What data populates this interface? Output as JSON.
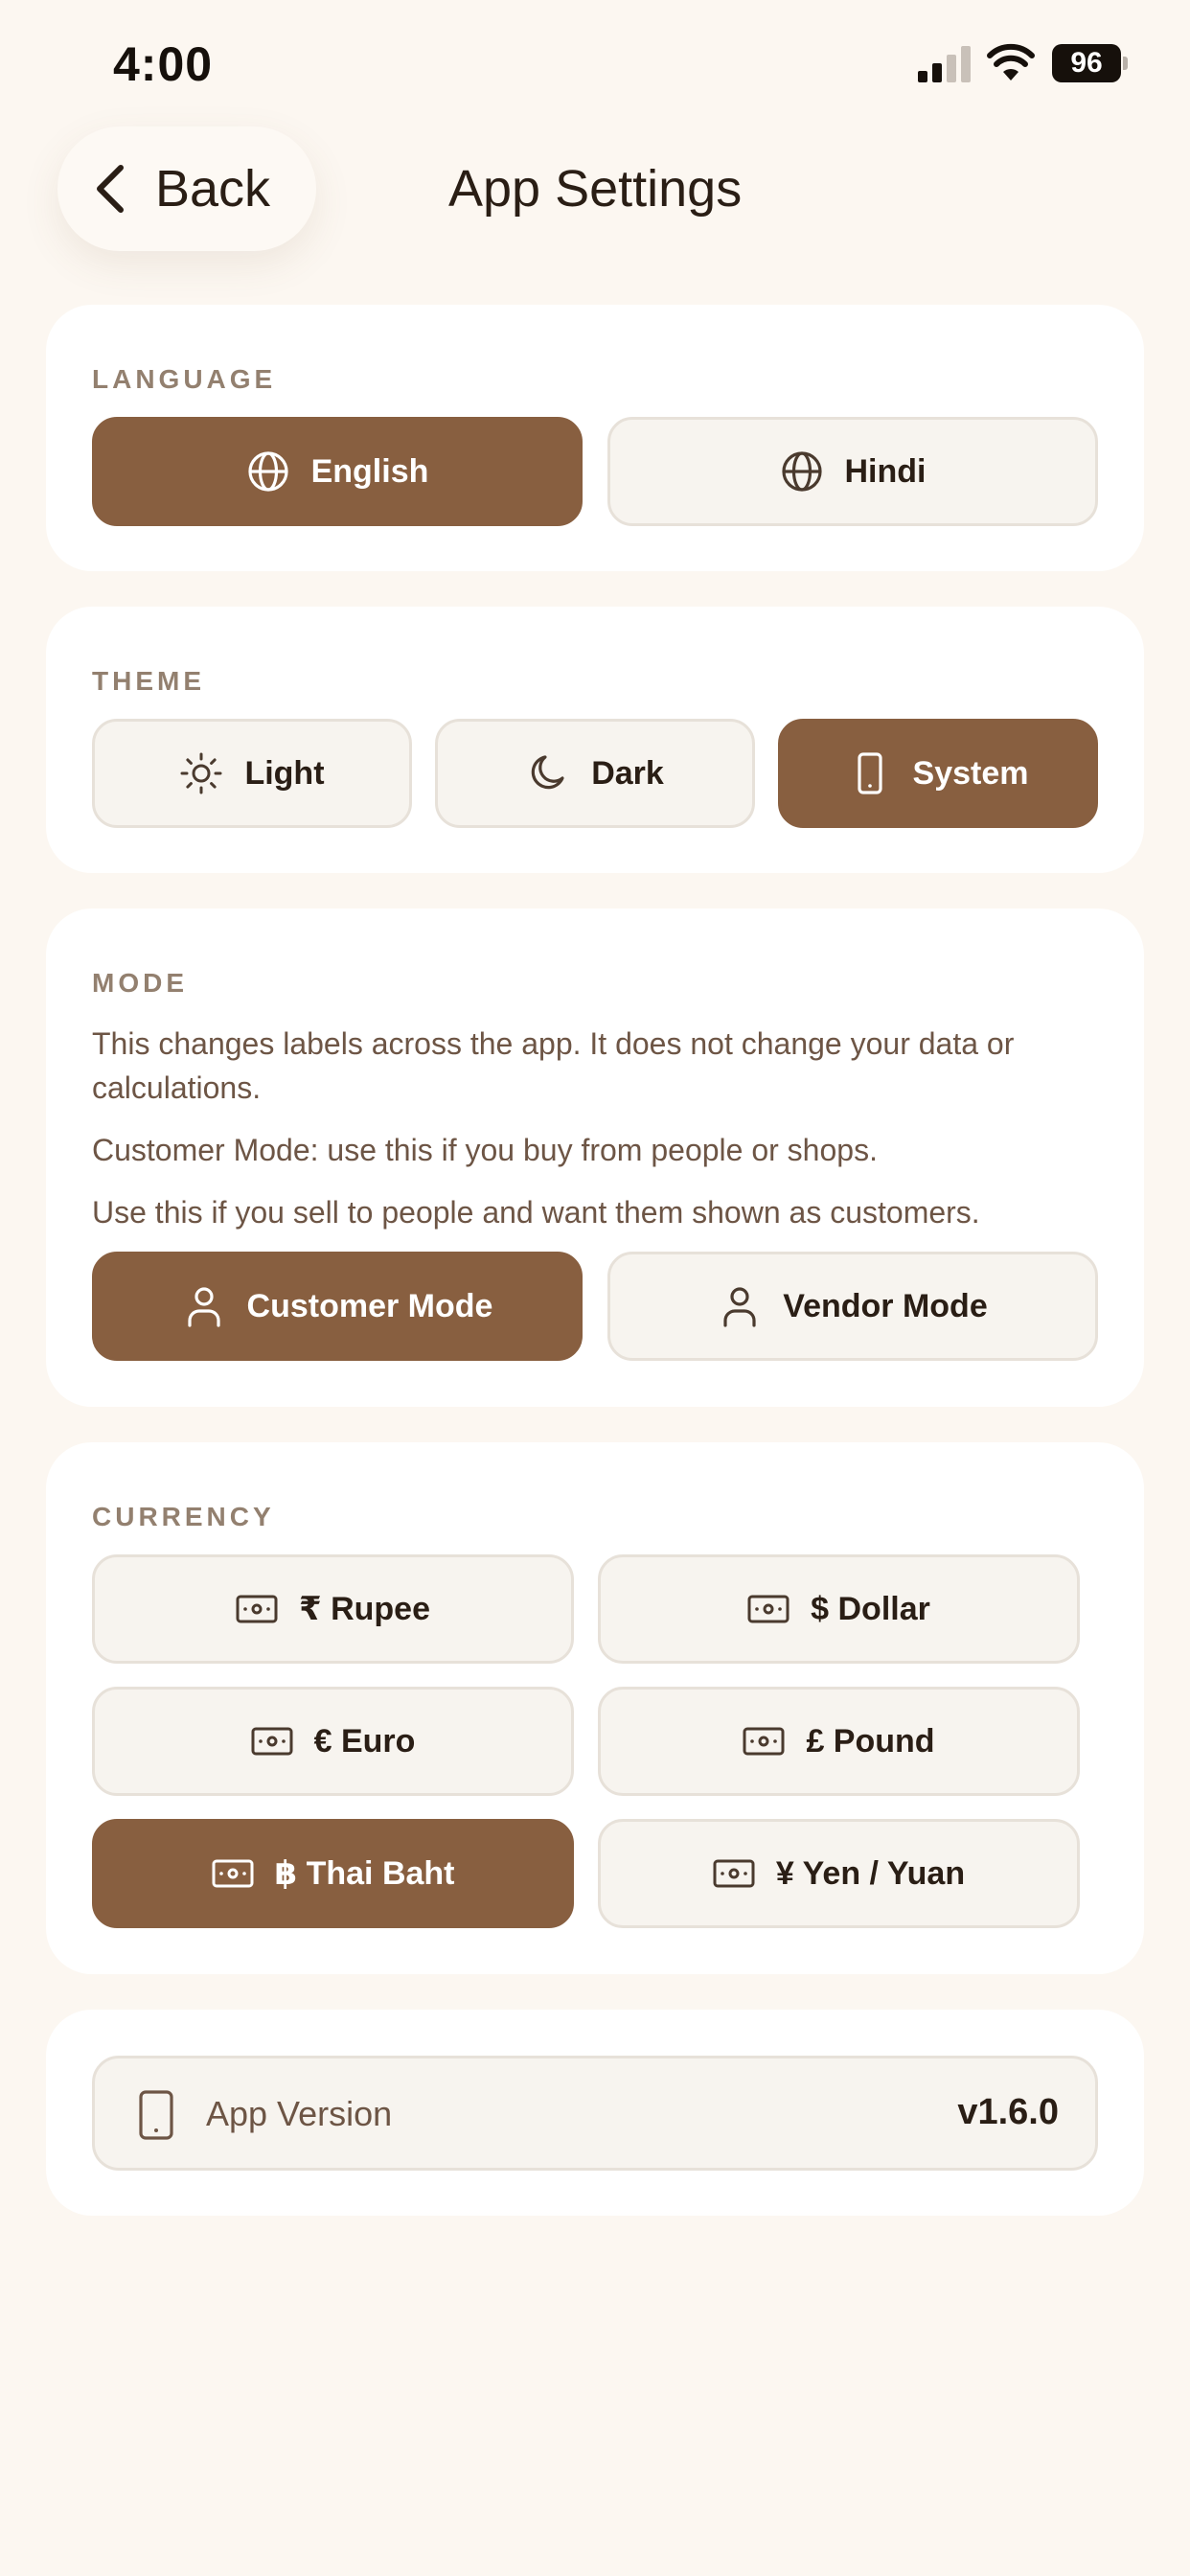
{
  "status_bar": {
    "time": "4:00",
    "battery": "96"
  },
  "header": {
    "back_label": "Back",
    "title": "App Settings"
  },
  "language": {
    "label": "LANGUAGE",
    "options": [
      {
        "label": "English",
        "icon": "globe-icon",
        "selected": true
      },
      {
        "label": "Hindi",
        "icon": "globe-icon",
        "selected": false
      }
    ]
  },
  "theme": {
    "label": "THEME",
    "options": [
      {
        "label": "Light",
        "icon": "sun-icon",
        "selected": false
      },
      {
        "label": "Dark",
        "icon": "moon-icon",
        "selected": false
      },
      {
        "label": "System",
        "icon": "phone-icon",
        "selected": true
      }
    ]
  },
  "mode": {
    "label": "MODE",
    "description": "This changes labels across the app. It does not change your data or calculations.",
    "customer_help": "Customer Mode: use this if you buy from people or shops.",
    "vendor_help": "Use this if you sell to people and want them shown as customers.",
    "options": [
      {
        "label": "Customer Mode",
        "icon": "user-icon",
        "selected": true
      },
      {
        "label": "Vendor Mode",
        "icon": "user-icon",
        "selected": false
      }
    ]
  },
  "currency": {
    "label": "CURRENCY",
    "options": [
      {
        "label": "₹ Rupee",
        "icon": "cash-icon",
        "selected": false
      },
      {
        "label": "$ Dollar",
        "icon": "cash-icon",
        "selected": false
      },
      {
        "label": "€ Euro",
        "icon": "cash-icon",
        "selected": false
      },
      {
        "label": "£ Pound",
        "icon": "cash-icon",
        "selected": false
      },
      {
        "label": "฿ Thai Baht",
        "icon": "cash-icon",
        "selected": true
      },
      {
        "label": "¥ Yen / Yuan",
        "icon": "cash-icon",
        "selected": false
      }
    ]
  },
  "app_version": {
    "label": "App Version",
    "value": "v1.6.0",
    "icon": "phone-icon"
  },
  "colors": {
    "background": "#fcf7f1",
    "accent": "#885f40",
    "card": "#ffffff",
    "option_bg": "#f7f4ef",
    "section_label": "#93806f"
  }
}
